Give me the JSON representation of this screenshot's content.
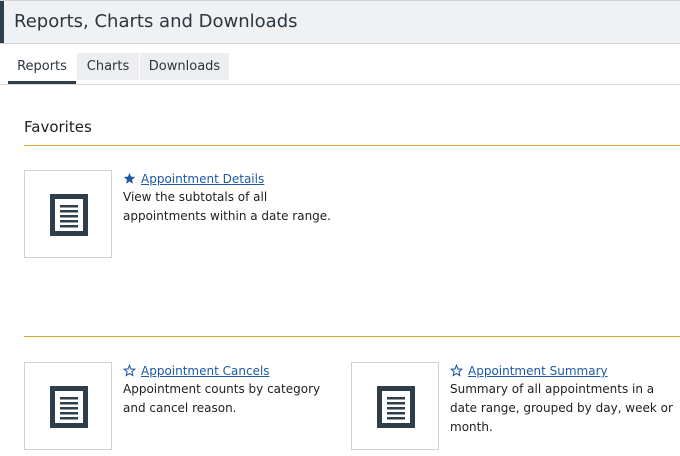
{
  "page": {
    "title": "Reports, Charts and Downloads"
  },
  "tabs": [
    {
      "label": "Reports",
      "active": true
    },
    {
      "label": "Charts",
      "active": false
    },
    {
      "label": "Downloads",
      "active": false
    }
  ],
  "favorites": {
    "heading": "Favorites",
    "items": [
      {
        "title": "Appointment Details",
        "description": "View the subtotals of all appointments within a date range.",
        "starred": true,
        "icon": "document-icon"
      }
    ]
  },
  "reports": {
    "items": [
      {
        "title": "Appointment Cancels",
        "description": "Appointment counts by category and cancel reason.",
        "starred": false,
        "icon": "document-icon"
      },
      {
        "title": "Appointment Summary",
        "description": "Summary of all appointments in a date range, grouped by day, week or month.",
        "starred": false,
        "icon": "document-icon"
      }
    ]
  },
  "colors": {
    "accent_rule": "#e0a52b",
    "link": "#1f5aa6",
    "icon_dark": "#2f3e4b",
    "star_filled": "#1f5aa6"
  }
}
